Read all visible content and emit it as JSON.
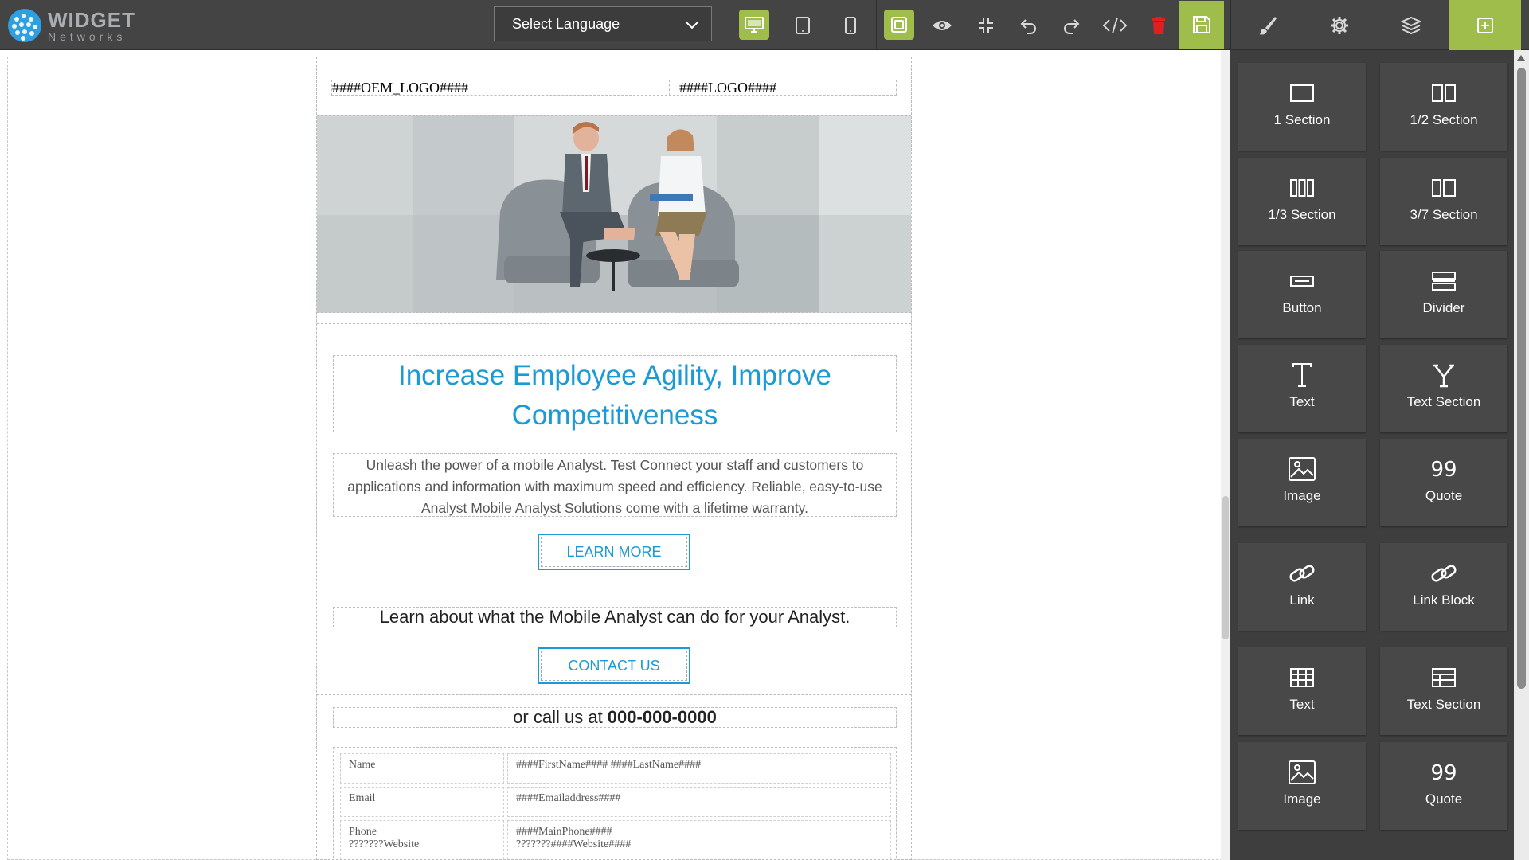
{
  "brand": {
    "name_line1": "WIDGET",
    "name_line2": "Networks"
  },
  "toolbar": {
    "language_label": "Select Language",
    "icons": [
      "desktop-view-icon",
      "tablet-view-icon",
      "mobile-view-icon",
      "outline-toggle-icon",
      "preview-icon",
      "fullscreen-icon",
      "undo-icon",
      "redo-icon",
      "code-icon",
      "delete-icon",
      "save-icon"
    ],
    "right_tabs": [
      "style-manager-icon",
      "settings-icon",
      "layers-icon",
      "add-block-icon"
    ]
  },
  "email": {
    "oem_logo": "####OEM_LOGO####",
    "logo": "####LOGO####",
    "headline_line1": "Increase Employee Agility, Improve",
    "headline_line2": "Competitiveness",
    "desc_line1": "Unleash the power of a mobile Analyst. Test Connect your staff and customers to",
    "desc_line2": "applications and information with maximum speed and efficiency. Reliable, easy-to-use",
    "desc_line3": "Analyst Mobile Analyst Solutions come with a lifetime warranty.",
    "learn_more": "LEARN MORE",
    "learn_text": "Learn about what the Mobile Analyst can do for your Analyst.",
    "contact_us": "CONTACT US",
    "call_prefix": "or call us at ",
    "phone": "000-000-0000",
    "table": [
      {
        "k": "Name",
        "v": "####FirstName#### ####LastName####"
      },
      {
        "k": "Email",
        "v": "####Emailaddress####"
      },
      {
        "k1": "Phone",
        "k2": "???????Website",
        "v1": "####MainPhone####",
        "v2": "???????####Website####"
      }
    ]
  },
  "blocks": [
    {
      "label": "1 Section",
      "icon": "one-section-icon"
    },
    {
      "label": "1/2 Section",
      "icon": "half-section-icon"
    },
    {
      "label": "1/3 Section",
      "icon": "third-section-icon"
    },
    {
      "label": "3/7 Section",
      "icon": "three-seven-section-icon"
    },
    {
      "label": "Button",
      "icon": "button-icon"
    },
    {
      "label": "Divider",
      "icon": "divider-icon"
    },
    {
      "label": "Text",
      "icon": "text-icon"
    },
    {
      "label": "Text Section",
      "icon": "text-section-icon"
    },
    {
      "label": "Image",
      "icon": "image-icon"
    },
    {
      "label": "Quote",
      "icon": "quote-icon"
    },
    {
      "label": "Link",
      "icon": "link-icon"
    },
    {
      "label": "Link Block",
      "icon": "link-block-icon"
    },
    {
      "label": "Text",
      "icon": "table-icon"
    },
    {
      "label": "Text Section",
      "icon": "table-section-icon"
    },
    {
      "label": "Image",
      "icon": "image-icon"
    },
    {
      "label": "Quote",
      "icon": "quote-icon"
    }
  ],
  "colors": {
    "accent_green": "#9fbd4b",
    "accent_blue": "#1b9ad6",
    "delete_red": "#e02020"
  }
}
